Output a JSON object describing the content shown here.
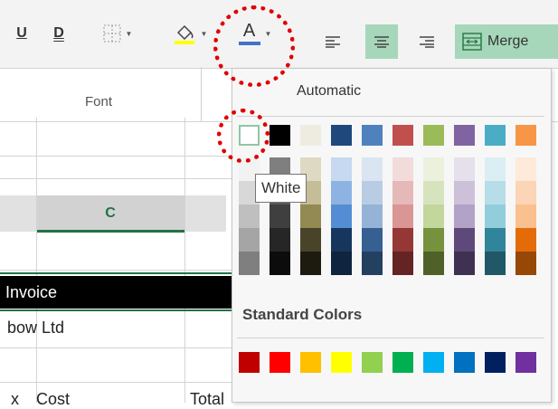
{
  "ribbon": {
    "underline_label": "U",
    "double_underline_label": "D",
    "font_color_label": "A",
    "merge_label": "Merge",
    "group_label": "Font",
    "font_color_accent": "#4472c4",
    "highlight_accent": "#ffff00"
  },
  "sheet": {
    "column_label": "C",
    "invoice_text": "Invoice",
    "company_text": "bow Ltd",
    "cost_text": "Cost",
    "total_text": "Total",
    "x_text": "x"
  },
  "palette": {
    "automatic_label": "Automatic",
    "tooltip": "White",
    "standard_label": "Standard Colors",
    "theme_top": [
      "#ffffff",
      "#000000",
      "#eeece1",
      "#1f497d",
      "#4f81bd",
      "#c0504d",
      "#9bbb59",
      "#8064a2",
      "#4bacc6",
      "#f79646"
    ],
    "theme_shades": [
      [
        "#f2f2f2",
        "#d8d8d8",
        "#bfbfbf",
        "#a5a5a5",
        "#7f7f7f"
      ],
      [
        "#7f7f7f",
        "#595959",
        "#3f3f3f",
        "#262626",
        "#0c0c0c"
      ],
      [
        "#ddd9c3",
        "#c4bd97",
        "#938953",
        "#494429",
        "#1d1b10"
      ],
      [
        "#c6d9f0",
        "#8db3e2",
        "#548dd4",
        "#17365d",
        "#0f243e"
      ],
      [
        "#dbe5f1",
        "#b8cce4",
        "#95b3d7",
        "#366092",
        "#244061"
      ],
      [
        "#f2dcdb",
        "#e5b9b7",
        "#d99694",
        "#953734",
        "#632423"
      ],
      [
        "#ebf1dd",
        "#d7e3bc",
        "#c3d69b",
        "#76923c",
        "#4f6128"
      ],
      [
        "#e5e0ec",
        "#ccc1d9",
        "#b2a2c7",
        "#5f497a",
        "#3f3151"
      ],
      [
        "#dbeef3",
        "#b7dde8",
        "#92cddc",
        "#31859b",
        "#205867"
      ],
      [
        "#fdeada",
        "#fbd5b5",
        "#fac08f",
        "#e36c09",
        "#974806"
      ]
    ],
    "standard": [
      "#c00000",
      "#ff0000",
      "#ffc000",
      "#ffff00",
      "#92d050",
      "#00b050",
      "#00b0f0",
      "#0070c0",
      "#002060",
      "#7030a0"
    ]
  }
}
